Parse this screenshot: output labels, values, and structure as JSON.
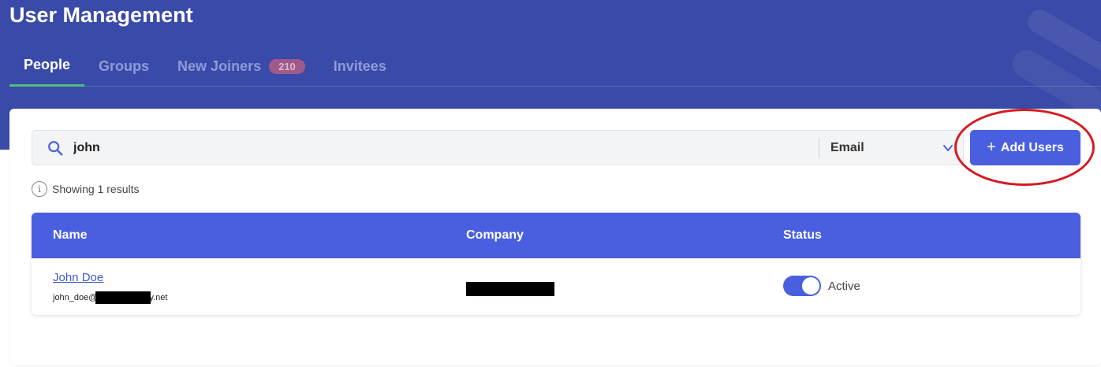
{
  "header": {
    "title": "User Management",
    "tabs": [
      {
        "label": "People",
        "active": true
      },
      {
        "label": "Groups",
        "active": false
      },
      {
        "label": "New Joiners",
        "badge": "210",
        "active": false
      },
      {
        "label": "Invitees",
        "active": false
      }
    ]
  },
  "search": {
    "value": "john",
    "filter_selected": "Email",
    "icon": "search-icon"
  },
  "actions": {
    "add_users_label": "Add Users"
  },
  "results": {
    "summary": "Showing 1 results"
  },
  "table": {
    "columns": [
      "Name",
      "Company",
      "Status"
    ],
    "rows": [
      {
        "name": "John Doe",
        "email_prefix": "john_doe@",
        "email_suffix": "y.net",
        "status": "Active",
        "status_on": true
      }
    ]
  },
  "colors": {
    "banner": "#3a4aa8",
    "accent": "#4a5fe0",
    "active_tab_underline": "#4fc07b",
    "highlight_ring": "#d81920"
  }
}
